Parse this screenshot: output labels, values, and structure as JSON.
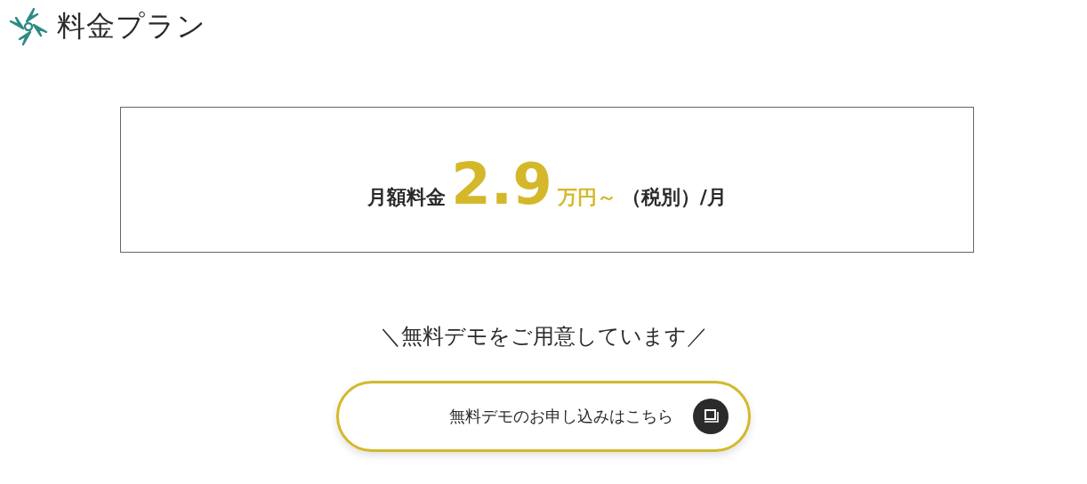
{
  "heading": {
    "title": "料金プラン"
  },
  "price": {
    "label": "月額料金",
    "amount": "2.9",
    "unit": "万円～",
    "note": "（税別）/月"
  },
  "tagline": "＼無料デモをご用意しています／",
  "cta_button": {
    "label": "無料デモのお申し込みはこちら"
  }
}
